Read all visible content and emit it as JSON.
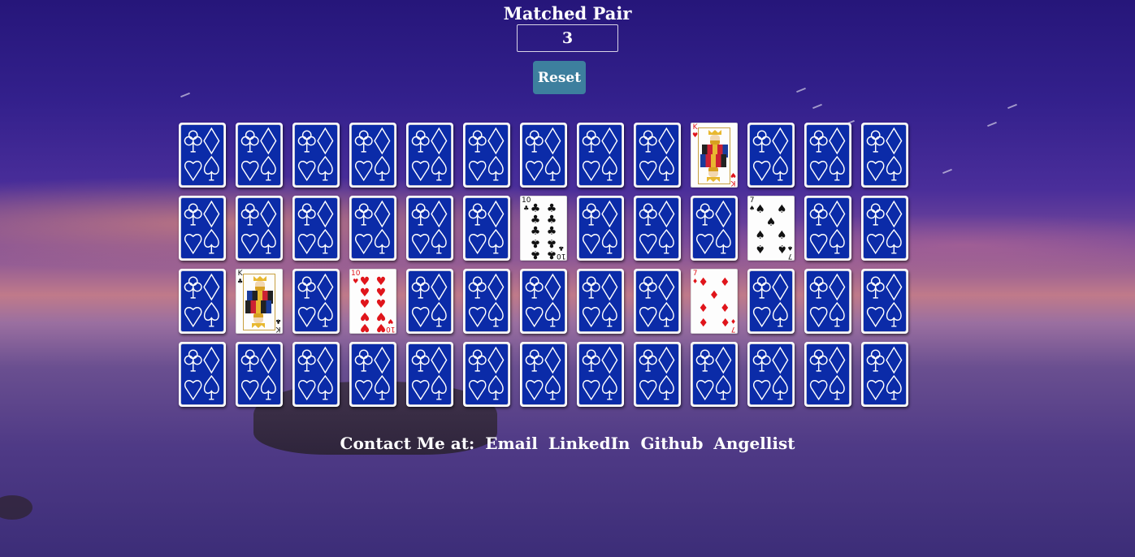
{
  "score": {
    "label": "Matched Pair",
    "value": "3"
  },
  "controls": {
    "reset_label": "Reset"
  },
  "board": {
    "columns": 13,
    "rows": 4,
    "card_back_icon": "card-back-suits-icon",
    "revealed": [
      {
        "row": 1,
        "col": 10,
        "rank": "K",
        "suit": "hearts",
        "color": "#e0151b"
      },
      {
        "row": 2,
        "col": 7,
        "rank": "10",
        "suit": "clubs",
        "color": "#111111"
      },
      {
        "row": 2,
        "col": 11,
        "rank": "7",
        "suit": "spades",
        "color": "#111111"
      },
      {
        "row": 3,
        "col": 2,
        "rank": "K",
        "suit": "clubs",
        "color": "#111111"
      },
      {
        "row": 3,
        "col": 4,
        "rank": "10",
        "suit": "hearts",
        "color": "#e0151b"
      },
      {
        "row": 3,
        "col": 10,
        "rank": "7",
        "suit": "diamonds",
        "color": "#e0151b"
      }
    ]
  },
  "footer": {
    "prefix": "Contact Me at:",
    "links": [
      "Email",
      "LinkedIn",
      "Github",
      "Angellist"
    ]
  },
  "colors": {
    "card_back": "#0b2ba8",
    "reset_button": "#3d7f9e"
  }
}
